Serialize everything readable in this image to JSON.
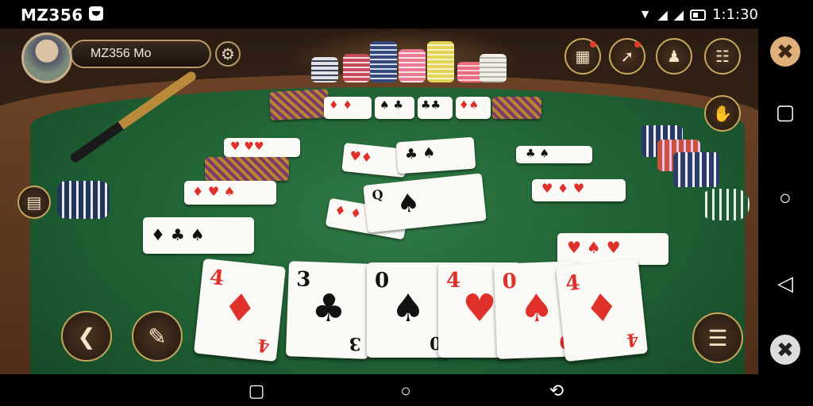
{
  "status_bar": {
    "title": "MZ356",
    "time": "1:1:30"
  },
  "player": {
    "name": "MZ356 Mo"
  },
  "table": {
    "hand": [
      {
        "rank": "4",
        "suit": "♦",
        "color": "red"
      },
      {
        "rank": "3",
        "suit": "♣",
        "color": "black"
      },
      {
        "rank": "0",
        "suit": "♠",
        "color": "black"
      },
      {
        "rank": "4",
        "suit": "♥",
        "color": "red"
      },
      {
        "rank": "0",
        "suit": "♠",
        "color": "red"
      },
      {
        "rank": "4",
        "suit": "♦",
        "color": "red"
      }
    ]
  },
  "icons": {
    "settings": "gear-icon",
    "top_controls": [
      "card-table-icon",
      "cue-icon",
      "player-icon",
      "building-icon"
    ],
    "left_control": "map-icon",
    "right_control": "hand-icon",
    "bottom_left": [
      "back-icon",
      "folder-icon"
    ],
    "bottom_right": "menu-icon"
  },
  "colors": {
    "felt": "#1f5f33",
    "rail": "#5a3620",
    "accent": "#c6a55c",
    "red_suit": "#e0302a"
  }
}
